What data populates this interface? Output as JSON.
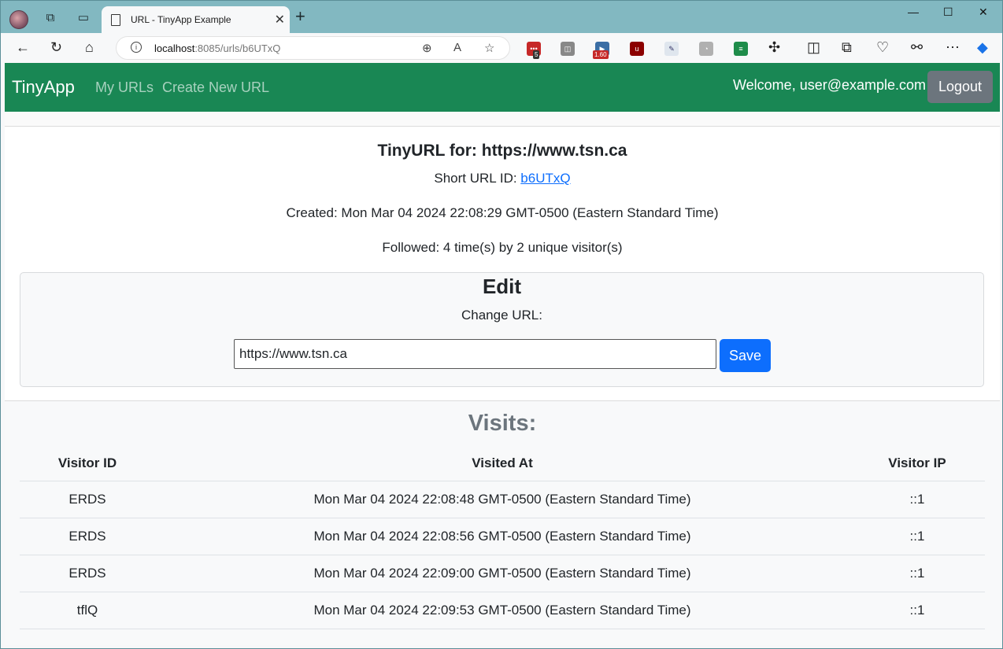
{
  "browser": {
    "tab_title": "URL - TinyApp Example",
    "url_host": "localhost",
    "url_path": ":8085/urls/b6UTxQ",
    "ext_badges": [
      "5",
      "1.60"
    ]
  },
  "app": {
    "brand": "TinyApp",
    "nav": [
      "My URLs",
      "Create New URL"
    ],
    "welcome": "Welcome, user@example.com",
    "logout_label": "Logout"
  },
  "details": {
    "heading": "TinyURL for: https://www.tsn.ca",
    "short_label": "Short URL ID: ",
    "short_id": "b6UTxQ",
    "created": "Created: Mon Mar 04 2024 22:08:29 GMT-0500 (Eastern Standard Time)",
    "followed": "Followed: 4 time(s) by 2 unique visitor(s)"
  },
  "edit": {
    "title": "Edit",
    "label": "Change URL:",
    "value": "https://www.tsn.ca",
    "save_label": "Save"
  },
  "visits": {
    "title": "Visits:",
    "headers": [
      "Visitor ID",
      "Visited At",
      "Visitor IP"
    ],
    "rows": [
      [
        "ERDS",
        "Mon Mar 04 2024 22:08:48 GMT-0500 (Eastern Standard Time)",
        "::1"
      ],
      [
        "ERDS",
        "Mon Mar 04 2024 22:08:56 GMT-0500 (Eastern Standard Time)",
        "::1"
      ],
      [
        "ERDS",
        "Mon Mar 04 2024 22:09:00 GMT-0500 (Eastern Standard Time)",
        "::1"
      ],
      [
        "tflQ",
        "Mon Mar 04 2024 22:09:53 GMT-0500 (Eastern Standard Time)",
        "::1"
      ]
    ]
  }
}
